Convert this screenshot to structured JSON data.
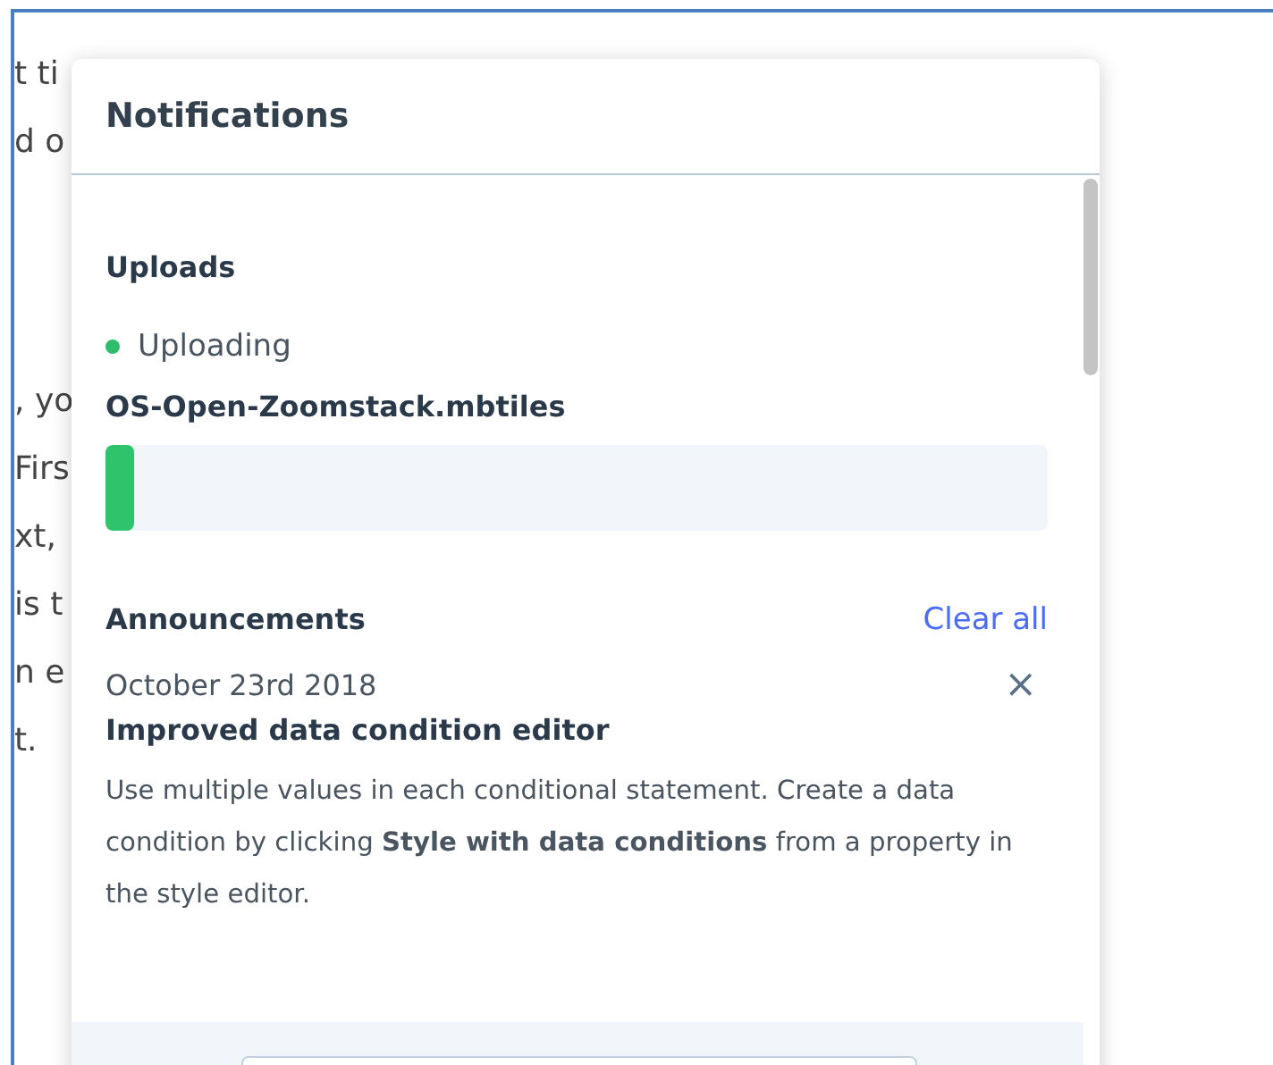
{
  "background_text": [
    "t ti",
    "d o",
    ", yo",
    "Firs",
    "xt,",
    "is t",
    "n e",
    "t."
  ],
  "panel": {
    "title": "Notifications",
    "uploads": {
      "heading": "Uploads",
      "items": [
        {
          "status": "Uploading",
          "color": "#2ebd6b",
          "file": "OS-Open-Zoomstack.mbtiles",
          "level": 0.03
        }
      ]
    },
    "announcements": {
      "heading": "Announcements",
      "clear_action": "Clear all",
      "items": [
        {
          "date": "October 23rd 2018",
          "close": "×",
          "title": "Improved data condition editor",
          "body": "Use multiple values in each conditional statement. Create a data condition by clicking **Style with data conditions** from a property in the style editor."
        }
      ]
    }
  }
}
